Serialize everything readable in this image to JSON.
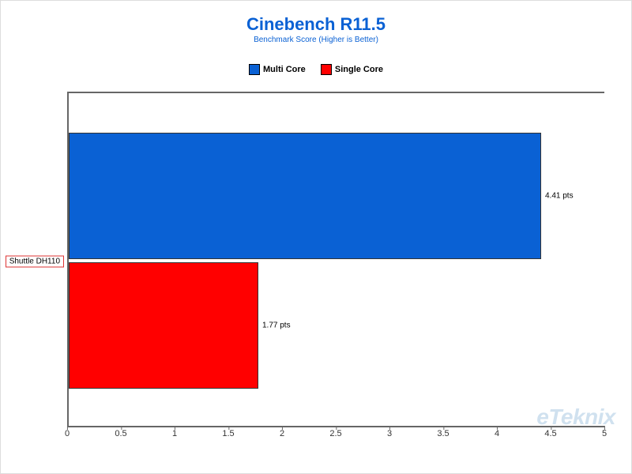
{
  "chart_data": {
    "type": "bar",
    "orientation": "horizontal",
    "title": "Cinebench R11.5",
    "subtitle": "Benchmark Score (Higher is Better)",
    "categories": [
      "Shuttle DH110"
    ],
    "series": [
      {
        "name": "Multi Core",
        "color": "#0a61d4",
        "values": [
          4.41
        ],
        "labels": [
          "4.41 pts"
        ]
      },
      {
        "name": "Single Core",
        "color": "#ff0000",
        "values": [
          1.77
        ],
        "labels": [
          "1.77 pts"
        ]
      }
    ],
    "x_ticks": [
      0,
      0.5,
      1,
      1.5,
      2,
      2.5,
      3,
      3.5,
      4,
      4.5,
      5
    ],
    "xlim": [
      0,
      5
    ],
    "xlabel": "",
    "ylabel": ""
  },
  "legend": {
    "multi": "Multi Core",
    "single": "Single Core"
  },
  "axis_labels": {
    "category0": "Shuttle DH110"
  },
  "bar_labels": {
    "multi": "4.41 pts",
    "single": "1.77 pts"
  },
  "x_ticks_text": {
    "t0": "0",
    "t1": "0.5",
    "t2": "1",
    "t3": "1.5",
    "t4": "2",
    "t5": "2.5",
    "t6": "3",
    "t7": "3.5",
    "t8": "4",
    "t9": "4.5",
    "t10": "5"
  },
  "colors": {
    "multi": "#0a61d4",
    "single": "#ff0000",
    "title": "#0a61d4"
  },
  "watermark": "eTeknix"
}
